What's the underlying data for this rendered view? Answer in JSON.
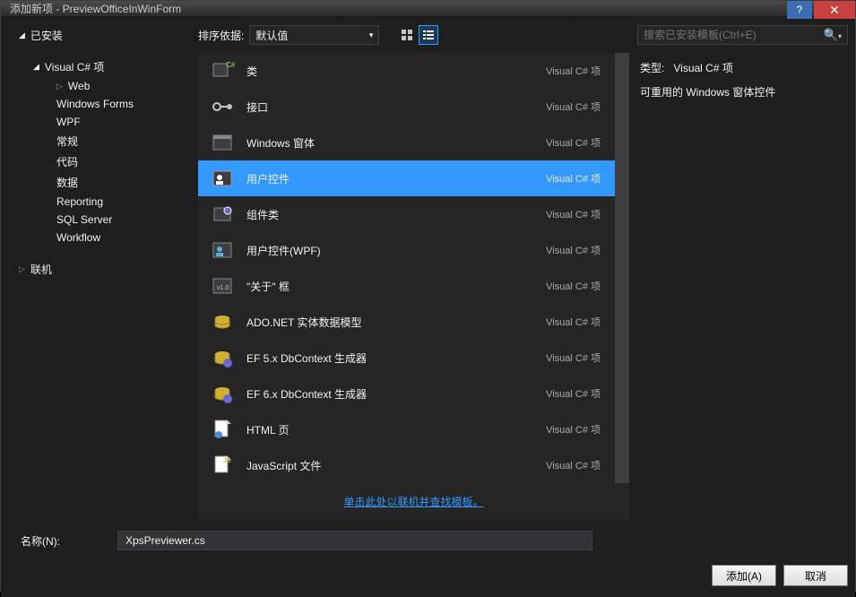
{
  "window": {
    "title": "添加新项 - PreviewOfficeInWinForm"
  },
  "tabs": {
    "installed": "已安装",
    "online": "联机"
  },
  "sort": {
    "label": "排序依据:",
    "value": "默认值"
  },
  "search": {
    "placeholder": "搜索已安装模板(Ctrl+E)"
  },
  "tree": {
    "root": "Visual C# 项",
    "items": [
      "Web",
      "Windows Forms",
      "WPF",
      "常规",
      "代码",
      "数据",
      "Reporting",
      "SQL Server",
      "Workflow"
    ]
  },
  "templates": [
    {
      "name": "类",
      "type": "Visual C# 项",
      "icon": "class"
    },
    {
      "name": "接口",
      "type": "Visual C# 项",
      "icon": "interface"
    },
    {
      "name": "Windows 窗体",
      "type": "Visual C# 项",
      "icon": "winform"
    },
    {
      "name": "用户控件",
      "type": "Visual C# 项",
      "icon": "usercontrol",
      "selected": true
    },
    {
      "name": "组件类",
      "type": "Visual C# 项",
      "icon": "component"
    },
    {
      "name": "用户控件(WPF)",
      "type": "Visual C# 项",
      "icon": "usercontrolwpf"
    },
    {
      "name": "\"关于\" 框",
      "type": "Visual C# 项",
      "icon": "about"
    },
    {
      "name": "ADO.NET 实体数据模型",
      "type": "Visual C# 项",
      "icon": "ado"
    },
    {
      "name": "EF 5.x DbContext 生成器",
      "type": "Visual C# 项",
      "icon": "ef"
    },
    {
      "name": "EF 6.x DbContext 生成器",
      "type": "Visual C# 项",
      "icon": "ef"
    },
    {
      "name": "HTML 页",
      "type": "Visual C# 项",
      "icon": "html"
    },
    {
      "name": "JavaScript 文件",
      "type": "Visual C# 项",
      "icon": "js"
    }
  ],
  "details": {
    "type_label": "类型:",
    "type_value": "Visual C# 项",
    "description": "可重用的 Windows 窗体控件"
  },
  "online_link": "单击此处以联机并查找模板。",
  "name_field": {
    "label": "名称(N):",
    "value": "XpsPreviewer.cs"
  },
  "buttons": {
    "add": "添加(A)",
    "cancel": "取消"
  }
}
